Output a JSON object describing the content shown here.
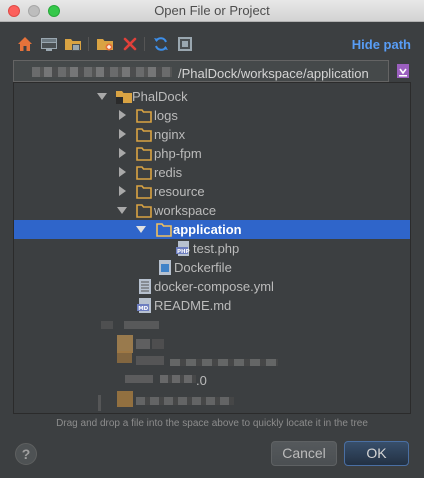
{
  "window": {
    "title": "Open File or Project"
  },
  "toolbar": {
    "hide_path_label": "Hide path",
    "buttons": [
      "home-icon",
      "desktop-icon",
      "project-folder-icon",
      "new-folder-icon",
      "delete-icon",
      "refresh-icon",
      "show-hidden-icon"
    ]
  },
  "path": {
    "value": "/PhalDock/workspace/application"
  },
  "tree": {
    "items": [
      {
        "label": "PhalDock",
        "kind": "project-folder",
        "expanded": true
      },
      {
        "label": "logs",
        "kind": "folder",
        "expanded": false
      },
      {
        "label": "nginx",
        "kind": "folder",
        "expanded": false
      },
      {
        "label": "php-fpm",
        "kind": "folder",
        "expanded": false
      },
      {
        "label": "redis",
        "kind": "folder",
        "expanded": false
      },
      {
        "label": "resource",
        "kind": "folder",
        "expanded": false
      },
      {
        "label": "workspace",
        "kind": "folder",
        "expanded": true
      },
      {
        "label": "application",
        "kind": "folder",
        "expanded": true,
        "selected": true
      },
      {
        "label": "test.php",
        "kind": "php-file"
      },
      {
        "label": "Dockerfile",
        "kind": "docker-file"
      },
      {
        "label": "docker-compose.yml",
        "kind": "yml-file"
      },
      {
        "label": "README.md",
        "kind": "md-file"
      }
    ],
    "blurred_trailing_text": ".0"
  },
  "hint": "Drag and drop a file into the space above to quickly locate it in the tree",
  "buttons": {
    "help": "?",
    "cancel": "Cancel",
    "ok": "OK"
  },
  "colors": {
    "accent": "#589df6",
    "selection": "#2f65ca",
    "background": "#3c3f41",
    "folder": "#d9a343"
  }
}
